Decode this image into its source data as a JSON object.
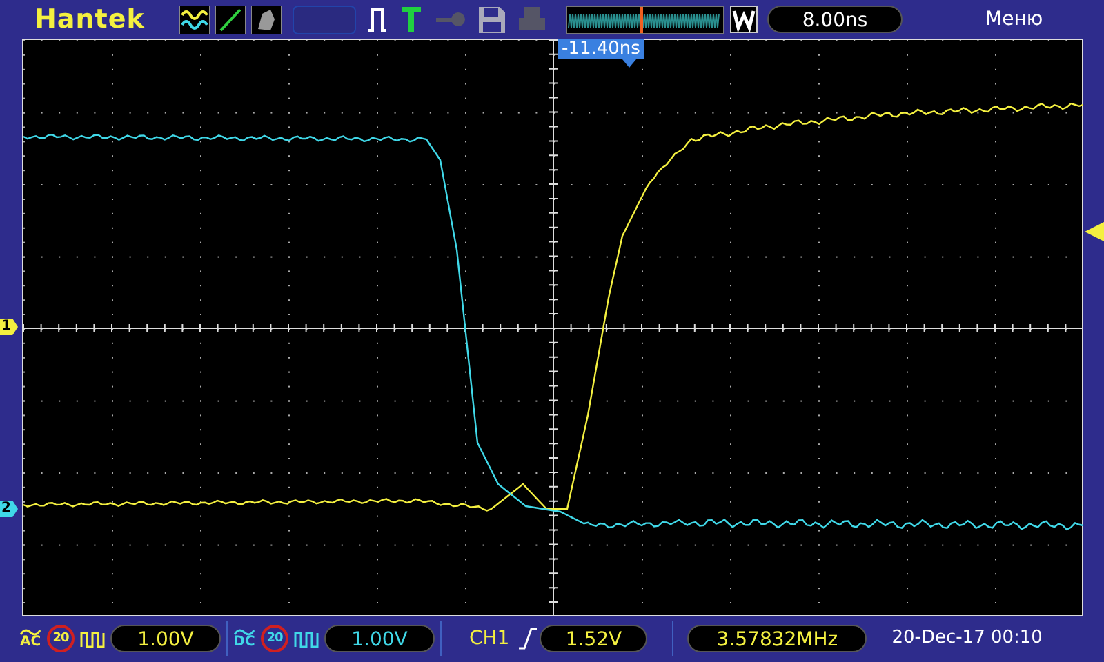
{
  "top_bar": {
    "brand": "Hantek",
    "timebase": "8.00ns",
    "menu": "Меню"
  },
  "trigger_position": "-11.40ns",
  "channels": [
    {
      "marker": "1",
      "color": "#f4f040",
      "coupling": "AC",
      "bandwidth_limit": "20",
      "scale": "1.00V"
    },
    {
      "marker": "2",
      "color": "#40d8e8",
      "coupling": "DC",
      "bandwidth_limit": "20",
      "scale": "1.00V"
    }
  ],
  "trigger": {
    "source": "CH1",
    "level": "1.52V"
  },
  "frequency": "3.57832MHz",
  "datetime": "20-Dec-17 00:10"
}
